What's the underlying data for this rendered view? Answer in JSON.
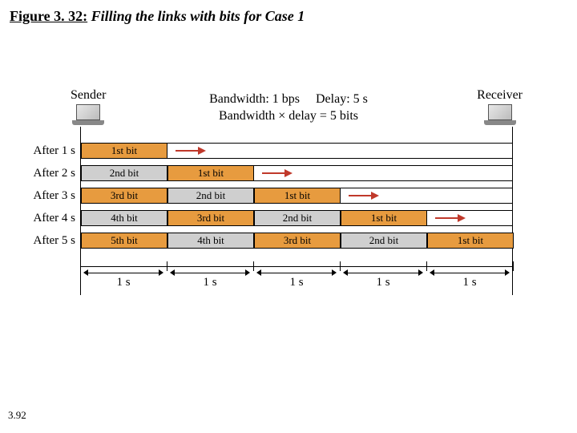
{
  "figure": {
    "number": "Figure 3. 32:",
    "title": "Filling the links with bits for Case 1"
  },
  "page": "3.92",
  "endpoints": {
    "sender": "Sender",
    "receiver": "Receiver"
  },
  "params": {
    "bandwidth": "Bandwidth: 1 bps",
    "delay": "Delay: 5 s",
    "product": "Bandwidth × delay = 5 bits"
  },
  "rows": [
    {
      "label": "After 1 s",
      "cells": [
        {
          "text": "1st bit",
          "color": "orange",
          "slot": 0
        }
      ],
      "arrowSlot": 1
    },
    {
      "label": "After 2 s",
      "cells": [
        {
          "text": "2nd bit",
          "color": "gray",
          "slot": 0
        },
        {
          "text": "1st bit",
          "color": "orange",
          "slot": 1
        }
      ],
      "arrowSlot": 2
    },
    {
      "label": "After 3 s",
      "cells": [
        {
          "text": "3rd bit",
          "color": "orange",
          "slot": 0
        },
        {
          "text": "2nd bit",
          "color": "gray",
          "slot": 1
        },
        {
          "text": "1st bit",
          "color": "orange",
          "slot": 2
        }
      ],
      "arrowSlot": 3
    },
    {
      "label": "After 4 s",
      "cells": [
        {
          "text": "4th bit",
          "color": "gray",
          "slot": 0
        },
        {
          "text": "3rd bit",
          "color": "orange",
          "slot": 1
        },
        {
          "text": "2nd bit",
          "color": "gray",
          "slot": 2
        },
        {
          "text": "1st bit",
          "color": "orange",
          "slot": 3
        }
      ],
      "arrowSlot": 4
    },
    {
      "label": "After 5 s",
      "cells": [
        {
          "text": "5th bit",
          "color": "orange",
          "slot": 0
        },
        {
          "text": "4th bit",
          "color": "gray",
          "slot": 1
        },
        {
          "text": "3rd bit",
          "color": "orange",
          "slot": 2
        },
        {
          "text": "2nd bit",
          "color": "gray",
          "slot": 3
        },
        {
          "text": "1st bit",
          "color": "orange",
          "slot": 4
        }
      ],
      "arrowSlot": null
    }
  ],
  "axis": {
    "segments": [
      "1 s",
      "1 s",
      "1 s",
      "1 s",
      "1 s"
    ]
  },
  "layout": {
    "slots": 5,
    "slotWidth": 108
  }
}
